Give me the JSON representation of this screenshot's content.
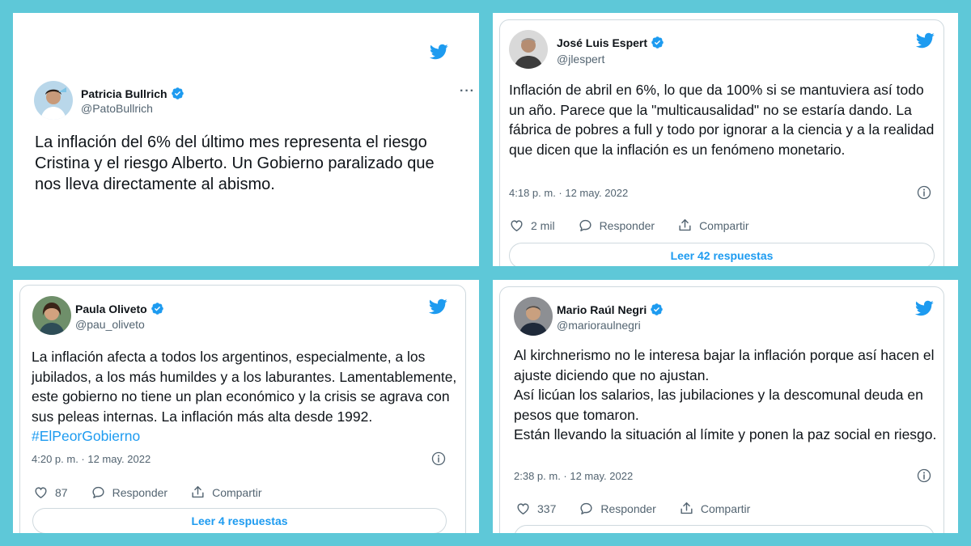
{
  "colors": {
    "background": "#5ec8d8",
    "twitter_blue": "#1d9bf0",
    "verified": "#1d9bf0",
    "secondary_text": "#536471"
  },
  "tweet1": {
    "name": "Patricia Bullrich",
    "handle": "@PatoBullrich",
    "text": "La inflación del 6% del último mes representa el riesgo Cristina y el riesgo Alberto. Un Gobierno paralizado que nos lleva directamente al abismo.",
    "more": "···"
  },
  "tweet2": {
    "name": "José Luis Espert",
    "handle": "@jlespert",
    "text": "Inflación de abril en 6%, lo que da 100% si se mantuviera así todo un año. Parece que la \"multicausalidad\" no se estaría dando. La fábrica de pobres a full y todo por ignorar a la ciencia y a la realidad que dicen que la inflación es un fenómeno monetario.",
    "timestamp": "4:18 p. m. · 12 may. 2022",
    "likes": "2 mil",
    "reply_label": "Responder",
    "share_label": "Compartir",
    "read_label": "Leer 42 respuestas"
  },
  "tweet3": {
    "name": "Paula Oliveto",
    "handle": "@pau_oliveto",
    "text": "La inflación afecta a todos los argentinos, especialmente, a los jubilados, a los más humildes y a los laburantes. Lamentablemente, este gobierno no tiene un plan económico y la crisis se agrava con sus peleas internas. La inflación más alta desde 1992. ",
    "hashtag": "#ElPeorGobierno",
    "timestamp": "4:20 p. m. · 12 may. 2022",
    "likes": "87",
    "reply_label": "Responder",
    "share_label": "Compartir",
    "read_label": "Leer 4 respuestas"
  },
  "tweet4": {
    "name": "Mario Raúl Negri",
    "handle": "@marioraulnegri",
    "text_lines": [
      "Al kirchnerismo no le interesa bajar la inflación porque así hacen el ajuste diciendo que no ajustan.",
      "Así licúan los salarios, las jubilaciones y la descomunal deuda en pesos que tomaron.",
      "Están llevando la situación al límite y ponen la paz social en riesgo."
    ],
    "timestamp": "2:38 p. m. · 12 may. 2022",
    "likes": "337",
    "reply_label": "Responder",
    "share_label": "Compartir"
  }
}
